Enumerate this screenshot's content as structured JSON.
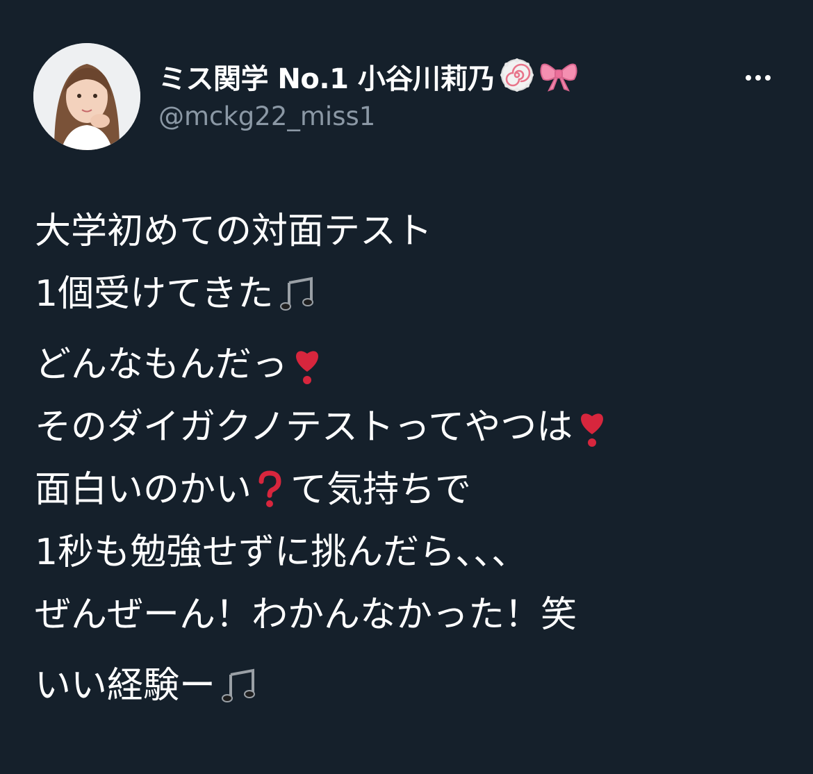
{
  "tweet": {
    "author": {
      "display_name": "ミス関学 No.1 小谷川莉乃",
      "name_emojis": [
        "naruto-icon",
        "ribbon-icon"
      ],
      "handle": "@mckg22_miss1"
    },
    "more_button_icon": "more-horizontal-icon",
    "text": {
      "line1": "大学初めての対面テスト",
      "line2": "1個受けてきた",
      "line3": "どんなもんだっ",
      "line4": "そのダイガクノテストってやつは",
      "line5a": "面白いのかい",
      "line5b": "て気持ちで",
      "line6": "1秒も勉強せずに挑んだら、、、",
      "line7": "ぜんぜーん！わかんなかった！笑",
      "line8": "いい経験ー"
    },
    "colors": {
      "background": "#15202b",
      "primary_text": "#ffffff",
      "secondary_text": "#8b98a5",
      "heart_red": "#d7263d"
    }
  }
}
